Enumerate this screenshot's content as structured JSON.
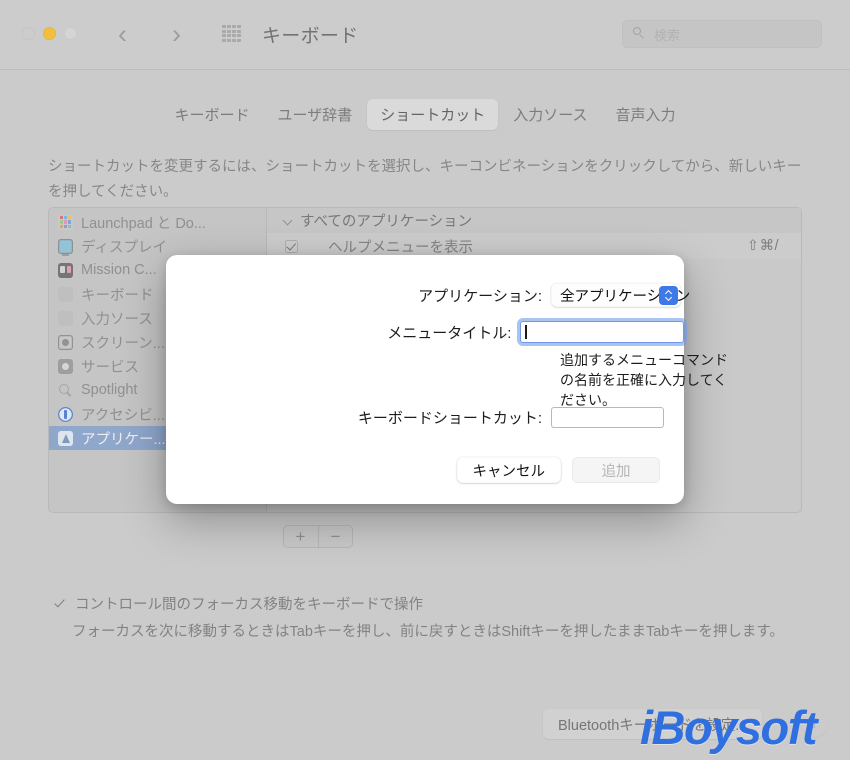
{
  "window": {
    "title": "キーボード",
    "traffic_lights": [
      "close",
      "minimize",
      "zoom"
    ],
    "nav_back": "‹",
    "nav_forward": "›",
    "grid_icon": "grid-icon",
    "search_placeholder": "検索"
  },
  "tabs": [
    {
      "label": "キーボード",
      "selected": false
    },
    {
      "label": "ユーザ辞書",
      "selected": false
    },
    {
      "label": "ショートカット",
      "selected": true
    },
    {
      "label": "入力ソース",
      "selected": false
    },
    {
      "label": "音声入力",
      "selected": false
    }
  ],
  "description": "ショートカットを変更するには、ショートカットを選択し、キーコンビネーションをクリックしてから、新しいキーを押してください。",
  "sidebar": {
    "items": [
      {
        "label": "Launchpad と Do...",
        "icon": "launchpad-icon",
        "selected": false
      },
      {
        "label": "ディスプレイ",
        "icon": "display-icon",
        "selected": false
      },
      {
        "label": "Mission C...",
        "icon": "mission-control-icon",
        "selected": false
      },
      {
        "label": "キーボード",
        "icon": "keyboard-icon",
        "selected": false
      },
      {
        "label": "入力ソース",
        "icon": "input-source-icon",
        "selected": false
      },
      {
        "label": "スクリーン...",
        "icon": "screenshot-icon",
        "selected": false
      },
      {
        "label": "サービス",
        "icon": "services-icon",
        "selected": false
      },
      {
        "label": "Spotlight",
        "icon": "spotlight-icon",
        "selected": false
      },
      {
        "label": "アクセシビ...",
        "icon": "accessibility-icon",
        "selected": false
      },
      {
        "label": "アプリケー...",
        "icon": "application-icon",
        "selected": true
      }
    ]
  },
  "shortcut_list": {
    "group_header": "すべてのアプリケーション",
    "rows": [
      {
        "name": "ヘルプメニューを表示",
        "shortcut": "⇧⌘/",
        "checked": true
      }
    ]
  },
  "list_buttons": {
    "add": "+",
    "remove": "−"
  },
  "focus_option": {
    "label": "コントロール間のフォーカス移動をキーボードで操作",
    "checked": true,
    "help": "フォーカスを次に移動するときはTabキーを押し、前に戻すときはShiftキーを押したままTabキーを押します。"
  },
  "bottom_bar": {
    "bluetooth_button": "Bluetoothキーボードを設定...",
    "help_button": "?"
  },
  "sheet": {
    "application_label": "アプリケーション:",
    "application_value": "全アプリケーション",
    "menu_title_label": "メニュータイトル:",
    "menu_title_value": "",
    "menu_title_hint": "追加するメニューコマンドの名前を正確に入力してください。",
    "shortcut_label": "キーボードショートカット:",
    "shortcut_value": "",
    "cancel_label": "キャンセル",
    "add_label": "追加"
  },
  "watermark": {
    "text": "iBoysoft"
  },
  "colors": {
    "accent_blue": "#3d79e8",
    "focus_ring": "#6a98ea",
    "selection_blue": "#8ba4cd",
    "window_bg": "#cbcbcb",
    "sheet_bg": "#ffffff",
    "watermark_blue": "#2f6fe0"
  }
}
